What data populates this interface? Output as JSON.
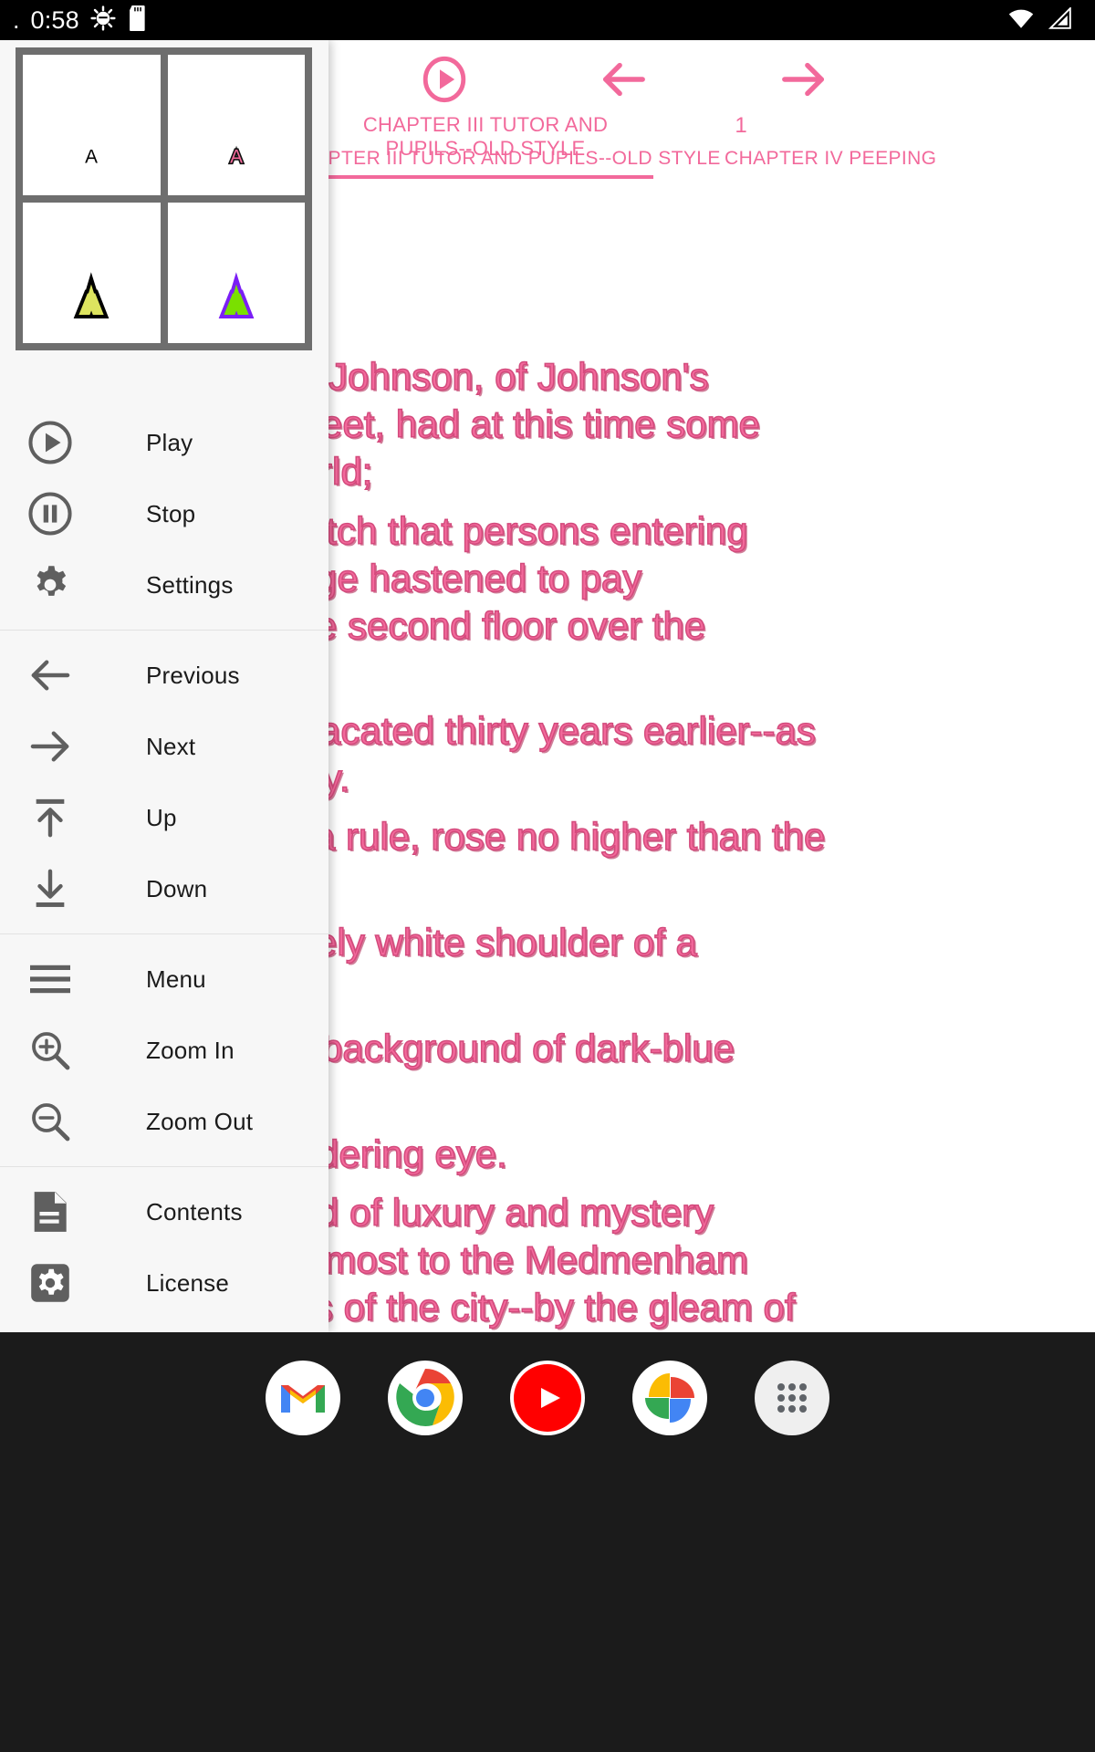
{
  "statusbar": {
    "leading_dot": ".",
    "clock": "0:58",
    "icons_left": [
      "android-debug-icon",
      "sd-card-icon"
    ],
    "icons_right": [
      "wifi-icon",
      "cellular-signal-icon"
    ]
  },
  "drawer": {
    "style_preview": {
      "title": "text-style-preview-grid",
      "cells": [
        {
          "name": "style-plain-black",
          "letter": "A",
          "fill": "#000000",
          "stroke": "none",
          "inner": "none"
        },
        {
          "name": "style-pink-outlined",
          "letter": "A",
          "fill": "#f46a9b",
          "stroke": "#111111",
          "inner": "none"
        },
        {
          "name": "style-black-yellow-inner",
          "letter": "A",
          "fill": "#000000",
          "stroke": "none",
          "inner": "#dde45f"
        },
        {
          "name": "style-purple-green",
          "letter": "A",
          "fill": "#7b1ff5",
          "stroke": "none",
          "inner": "#7ae000"
        }
      ]
    },
    "groups": [
      {
        "name": "playback-group",
        "items": [
          {
            "icon": "play-circle-icon",
            "label": "Play"
          },
          {
            "icon": "pause-circle-icon",
            "label": "Stop"
          },
          {
            "icon": "gear-icon",
            "label": "Settings"
          }
        ]
      },
      {
        "name": "navigation-group",
        "items": [
          {
            "icon": "arrow-left-icon",
            "label": "Previous"
          },
          {
            "icon": "arrow-right-icon",
            "label": "Next"
          },
          {
            "icon": "arrow-up-bar-icon",
            "label": "Up"
          },
          {
            "icon": "arrow-down-bar-icon",
            "label": "Down"
          }
        ]
      },
      {
        "name": "view-group",
        "items": [
          {
            "icon": "hamburger-menu-icon",
            "label": "Menu"
          },
          {
            "icon": "zoom-in-icon",
            "label": "Zoom In"
          },
          {
            "icon": "zoom-out-icon",
            "label": "Zoom Out"
          }
        ]
      },
      {
        "name": "document-group",
        "items": [
          {
            "icon": "document-icon",
            "label": "Contents"
          },
          {
            "icon": "gear-square-icon",
            "label": "License"
          }
        ]
      }
    ]
  },
  "reader": {
    "accent_color": "#f2699b",
    "toolbar": {
      "play_icon": "play-circle-icon",
      "prev_icon": "arrow-left-icon",
      "next_icon": "arrow-right-icon",
      "chapter_title": "CHAPTER III TUTOR AND PUPILS--OLD STYLE",
      "page_number": "1"
    },
    "tabs": {
      "active": "CHAPTER III TUTOR AND PUPILS--OLD STYLE",
      "next": "CHAPTER IV PEEPING"
    },
    "lines": [
      "Johnson, of Johnson's",
      "eet, had at this time some",
      "rld;",
      "itch that persons entering",
      "ge hastened to pay",
      "e second floor over the",
      "acated thirty years earlier--as",
      "y.",
      "a rule, rose no higher than the",
      "ely white shoulder of a",
      "background of dark-blue",
      "dering eye.",
      "d of luxury and mystery",
      "lmost to the Medmenham",
      "s of the city--by the gleam of"
    ]
  },
  "dock": {
    "apps": [
      {
        "name": "gmail-icon",
        "label": "Gmail"
      },
      {
        "name": "chrome-icon",
        "label": "Chrome"
      },
      {
        "name": "youtube-icon",
        "label": "YouTube"
      },
      {
        "name": "photos-icon",
        "label": "Photos"
      },
      {
        "name": "app-drawer-icon",
        "label": "Apps"
      }
    ]
  }
}
